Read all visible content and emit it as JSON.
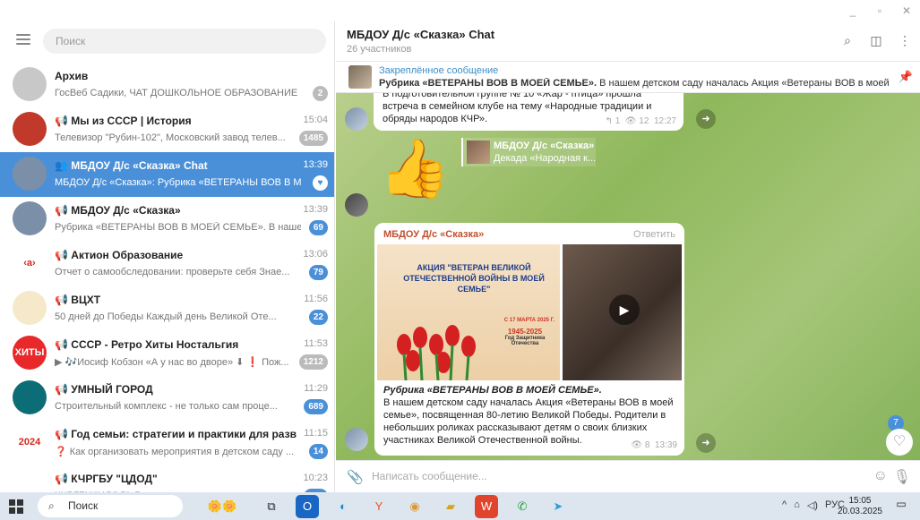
{
  "window": {
    "buttons": [
      "_",
      "▫",
      "✕"
    ]
  },
  "sidebar": {
    "search_placeholder": "Поиск",
    "chats": [
      {
        "name": "Архив",
        "time": "",
        "preview": "ГосВеб Садики, ЧАТ ДОШКОЛЬНОЕ ОБРАЗОВАНИЕ",
        "badge": "2",
        "badge_style": "grey",
        "avatar_color": "#c8c8c8"
      },
      {
        "name": "📢 Мы из СССР | История",
        "time": "15:04",
        "preview": "Телевизор \"Рубин-102\", Московский завод телев...",
        "badge": "1485",
        "badge_style": "grey",
        "avatar_color": "#c0392b"
      },
      {
        "name": "👥 МБДОУ Д/с «Сказка» Chat",
        "time": "13:39",
        "preview_sender": "МБДОУ Д/с «Сказка»:",
        "preview": "Рубрика «ВЕТЕРАНЫ ВОВ В МОЕЙ...",
        "badge": "♥",
        "badge_style": "white",
        "active": true,
        "avatar_color": "#7b8fa8"
      },
      {
        "name": "📢 МБДОУ Д/с «Сказка»",
        "time": "13:39",
        "preview": "Рубрика «ВЕТЕРАНЫ ВОВ В МОЕЙ СЕМЬЕ». В нашем...",
        "badge": "69",
        "badge_style": "blue",
        "avatar_color": "#7b8fa8"
      },
      {
        "name": "📢 Актион Образование",
        "time": "13:06",
        "preview": "Отчет о самообследовании: проверьте себя   Знае...",
        "badge": "79",
        "badge_style": "blue",
        "avatar_color": "#ffffff",
        "logo": "‹a›"
      },
      {
        "name": "📢 ВЦХТ",
        "time": "11:56",
        "preview": "50 дней до Победы   Каждый день Великой Оте...",
        "badge": "22",
        "badge_style": "blue",
        "avatar_color": "#f5e9c9"
      },
      {
        "name": "📢 СССР - Ретро Хиты Ностальгия",
        "time": "11:53",
        "preview": "▶ 🎶Иосиф Кобзон «А у нас во дворе» ⬇ ❗ Пож...",
        "badge": "1212",
        "badge_style": "grey",
        "avatar_color": "#e8282b",
        "logo": "ХИТЫ"
      },
      {
        "name": "📢 УМНЫЙ ГОРОД",
        "time": "11:29",
        "preview": "Строительный комплекс - не только сам проце...",
        "badge": "689",
        "badge_style": "blue",
        "avatar_color": "#0d6d77"
      },
      {
        "name": "📢 Год семьи: стратегии и практики для развития ...",
        "time": "11:15",
        "preview": "❓ Как организовать мероприятия в детском саду ...",
        "badge": "14",
        "badge_style": "blue",
        "avatar_color": "#ffffff",
        "logo": "2024"
      },
      {
        "name": "📢 КЧРГБУ \"ЦДОД\"",
        "time": "10:23",
        "preview": "КЧРГБУ \"ЦДОД\": Видео",
        "badge": "172",
        "badge_style": "blue",
        "avatar_color": "#ffffff"
      }
    ]
  },
  "chat": {
    "title": "МБДОУ Д/с «Сказка» Chat",
    "subtitle": "26 участников",
    "pinned": {
      "label": "Закреплённое сообщение",
      "text_bold": "Рубрика «ВЕТЕРАНЫ ВОВ В МОЕЙ СЕМЬЕ».",
      "text": " В нашем детском саду началась Акция «Ветераны ВОВ в моей семье»..."
    },
    "msg1": {
      "text": "В подготовительной группе № 10 «Жар - птица» прошла встреча в семейном клубе на тему «Народные традиции и обряды народов КЧР».",
      "replies": "1",
      "views": "12",
      "time": "12:27"
    },
    "quote": {
      "title": "МБДОУ Д/с «Сказка»",
      "text": "Декада «Народная к..."
    },
    "msg2": {
      "sender": "МБДОУ Д/с «Сказка»",
      "reply_label": "Ответить",
      "poster_title": "АКЦИЯ \"ВЕТЕРАН ВЕЛИКОЙ ОТЕЧЕСТВЕННОЙ ВОЙНЫ В МОЕЙ СЕМЬЕ\"",
      "poster_date": "С 17 МАРТА 2025 Г.",
      "poster_badge": "1945-2025",
      "poster_badge_sub": "Год Защитника Отечества",
      "caption_bold": "Рубрика «ВЕТЕРАНЫ ВОВ В МОЕЙ СЕМЬЕ».",
      "caption": "В нашем детском саду началась Акция «Ветераны ВОВ в моей семье», посвященная 80-летию Великой Победы. Родители в небольших роликах рассказывают детям о своих близких участниках Великой Отечественной войны.",
      "views": "8",
      "time": "13:39"
    },
    "reaction_count": "7",
    "composer_placeholder": "Написать сообщение..."
  },
  "taskbar": {
    "search_label": "Поиск",
    "lang": "РУС",
    "time": "15:05",
    "date": "20.03.2025"
  }
}
